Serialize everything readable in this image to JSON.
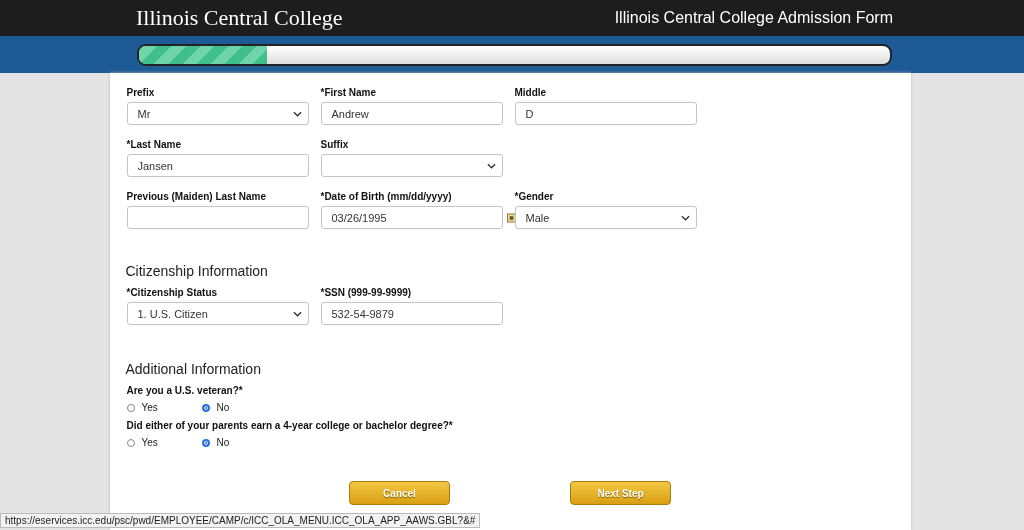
{
  "header": {
    "logo": "Illinois Central College",
    "title": "Illinois Central College Admission Form"
  },
  "progress": {
    "level": 0.17
  },
  "name_rows": [
    [
      {
        "kind": "select",
        "label": "Prefix",
        "value": "Mr"
      },
      {
        "kind": "text",
        "label": "*First Name",
        "value": "Andrew"
      },
      {
        "kind": "text",
        "label": "Middle",
        "value": "D"
      }
    ],
    [
      {
        "kind": "text",
        "label": "*Last Name",
        "value": "Jansen"
      },
      {
        "kind": "select",
        "label": "Suffix"
      }
    ],
    [
      {
        "kind": "text",
        "label": "Previous (Maiden) Last Name"
      },
      {
        "kind": "date",
        "label": "*Date of Birth (mm/dd/yyyy)",
        "value": "03/26/1995"
      },
      {
        "kind": "select",
        "label": "*Gender",
        "value": "Male"
      }
    ]
  ],
  "citizenship": {
    "heading": "Citizenship Information",
    "fields": [
      {
        "kind": "select",
        "label": "*Citizenship Status",
        "value": "1. U.S. Citizen"
      },
      {
        "kind": "text",
        "label": "*SSN (999-99-9999)",
        "value": "532-54-9879"
      }
    ]
  },
  "additional": {
    "heading": "Additional Information",
    "questions": [
      {
        "label": "Are you a U.S. veteran?*",
        "options": [
          {
            "label": "Yes",
            "selected": false
          },
          {
            "label": "No",
            "selected": true
          }
        ]
      },
      {
        "label": "Did either of your parents earn a 4-year college or bachelor degree?*",
        "options": [
          {
            "label": "Yes",
            "selected": false
          },
          {
            "label": "No",
            "selected": true
          }
        ]
      }
    ]
  },
  "buttons": [
    "Cancel",
    "Next Step"
  ],
  "status_url": "https://eservices.icc.edu/psc/pwd/EMPLOYEE/CAMP/c/ICC_OLA_MENU.ICC_OLA_APP_AAWS.GBL?&#"
}
